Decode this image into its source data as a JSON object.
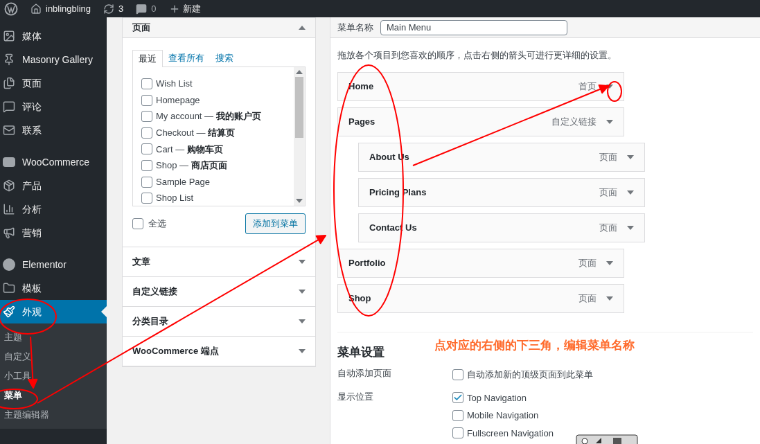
{
  "admin_bar": {
    "site": "inblingbling",
    "updates": "3",
    "comments": "0",
    "new": "新建"
  },
  "sidebar": {
    "items": [
      {
        "label": "媒体",
        "selected": false
      },
      {
        "label": "Masonry Gallery",
        "selected": false
      },
      {
        "label": "页面",
        "selected": false
      },
      {
        "label": "评论",
        "selected": false
      },
      {
        "label": "联系",
        "selected": false
      },
      {
        "label": "WooCommerce",
        "selected": false
      },
      {
        "label": "产品",
        "selected": false
      },
      {
        "label": "分析",
        "selected": false
      },
      {
        "label": "营销",
        "selected": false
      },
      {
        "label": "Elementor",
        "selected": false
      },
      {
        "label": "模板",
        "selected": false
      },
      {
        "label": "外观",
        "selected": true,
        "children": [
          {
            "label": "主题",
            "selected": false
          },
          {
            "label": "自定义",
            "selected": false
          },
          {
            "label": "小工具",
            "selected": false
          },
          {
            "label": "菜单",
            "selected": true
          },
          {
            "label": "主题编辑器",
            "selected": false
          }
        ]
      }
    ]
  },
  "add_items": {
    "sections": [
      {
        "title": "页面",
        "expanded": true,
        "tabs": [
          {
            "label": "最近",
            "selected": true
          },
          {
            "label": "查看所有",
            "selected": false
          },
          {
            "label": "搜索",
            "selected": false
          }
        ],
        "pages": [
          {
            "name": "Wish List",
            "checked": false
          },
          {
            "name": "Homepage",
            "checked": false
          },
          {
            "name": "My account — ",
            "suffix": "我的账户页",
            "checked": false
          },
          {
            "name": "Checkout — ",
            "suffix": "结算页",
            "checked": false
          },
          {
            "name": "Cart — ",
            "suffix": "购物车页",
            "checked": false
          },
          {
            "name": "Shop — ",
            "suffix": "商店页面",
            "checked": false
          },
          {
            "name": "Sample Page",
            "checked": false
          },
          {
            "name": "Shop List",
            "checked": false
          }
        ],
        "select_all": {
          "label": "全选",
          "checked": false
        },
        "add_button": "添加到菜单"
      },
      {
        "title": "文章",
        "expanded": false
      },
      {
        "title": "自定义链接",
        "expanded": false
      },
      {
        "title": "分类目录",
        "expanded": false
      },
      {
        "title": "WooCommerce 端点",
        "expanded": false
      }
    ]
  },
  "menu_structure": {
    "name_label": "菜单名称",
    "name_value": "Main Menu",
    "instructions": "拖放各个项目到您喜欢的顺序，点击右侧的箭头可进行更详细的设置。",
    "items": [
      {
        "title": "Home",
        "type": "首页"
      },
      {
        "title": "Pages",
        "type": "自定义链接",
        "children": [
          {
            "title": "About Us",
            "type": "页面"
          },
          {
            "title": "Pricing Plans",
            "type": "页面"
          },
          {
            "title": "Contact Us",
            "type": "页面"
          }
        ]
      },
      {
        "title": "Portfolio",
        "type": "页面"
      },
      {
        "title": "Shop",
        "type": "页面"
      }
    ]
  },
  "annotation": "点对应的右侧的下三角，编辑菜单名称",
  "menu_settings": {
    "title": "菜单设置",
    "rows": [
      {
        "label": "自动添加页面",
        "options": [
          {
            "label": "自动添加新的顶级页面到此菜单",
            "checked": false
          }
        ]
      },
      {
        "label": "显示位置",
        "options": [
          {
            "label": "Top Navigation",
            "checked": true
          },
          {
            "label": "Mobile Navigation",
            "checked": false
          },
          {
            "label": "Fullscreen Navigation",
            "checked": false
          }
        ]
      }
    ]
  }
}
